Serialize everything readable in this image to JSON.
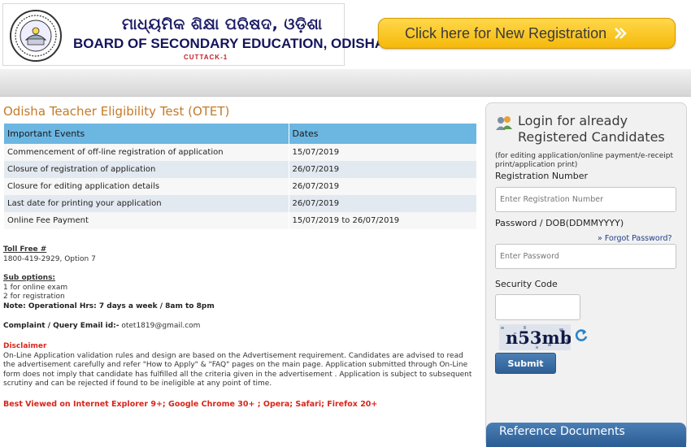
{
  "header": {
    "odia_title": "ମାଧ୍ୟମିକ ଶିକ୍ଷା ପରିଷଦ, ଓଡ଼ିଶା",
    "english_title": "BOARD OF SECONDARY EDUCATION, ODISHA",
    "sub_title": "CUTTACK-1",
    "registration_button": "Click here for New Registration"
  },
  "main": {
    "page_title": "Odisha Teacher Eligibility Test (OTET)",
    "table": {
      "headers": [
        "Important Events",
        "Dates"
      ],
      "rows": [
        [
          "Commencement of off-line registration of application",
          "15/07/2019"
        ],
        [
          "Closure of registration of application",
          "26/07/2019"
        ],
        [
          "Closure for editing application details",
          "26/07/2019"
        ],
        [
          "Last date for printing your application",
          "26/07/2019"
        ],
        [
          "Online Fee Payment",
          "15/07/2019 to 26/07/2019"
        ]
      ]
    },
    "toll_free_label": "Toll Free #",
    "toll_free_number": "1800-419-2929, Option 7",
    "sub_options_label": "Sub options:",
    "sub_option_1": "1 for online exam",
    "sub_option_2": "2 for registration",
    "operational_hours": "Note: Operational Hrs: 7 days a week / 8am to 8pm",
    "email_label": "Complaint / Query Email id:-",
    "email": "otet1819@gmail.com",
    "disclaimer_heading": "Disclaimer",
    "disclaimer_text": "On-Line Application validation rules and design are based on the Advertisement requirement. Candidates are advised to read the advertisement carefully and refer \"How to Apply\" & \"FAQ\" pages on the main page. Application submitted through On-Line form does not imply that candidate has fulfilled all the criteria given in the advertisement . Application is subject to subsequent scrutiny and can be rejected if found to be ineligible at any point of time.",
    "best_viewed": "Best Viewed on Internet Explorer 9+; Google Chrome 30+ ; Opera; Safari; Firefox 20+"
  },
  "login": {
    "title": "Login for already Registered Candidates",
    "subtitle": "(for editing application/online payment/e-receipt print/application print)",
    "registration_label": "Registration Number",
    "registration_placeholder": "Enter Registration Number",
    "password_label": "Password / DOB(DDMMYYYY)",
    "forgot_link": "Forgot Password?",
    "password_placeholder": "Enter Password",
    "security_label": "Security Code",
    "captcha_text": "n53mb",
    "submit_label": "Submit",
    "reference_documents": "Reference Documents"
  },
  "colors": {
    "accent_orange": "#c47a27",
    "table_header": "#6cb6e2",
    "button_yellow": "#f5b80a",
    "panel_blue": "#2d5f95",
    "disclaimer_red": "#d8261c"
  }
}
